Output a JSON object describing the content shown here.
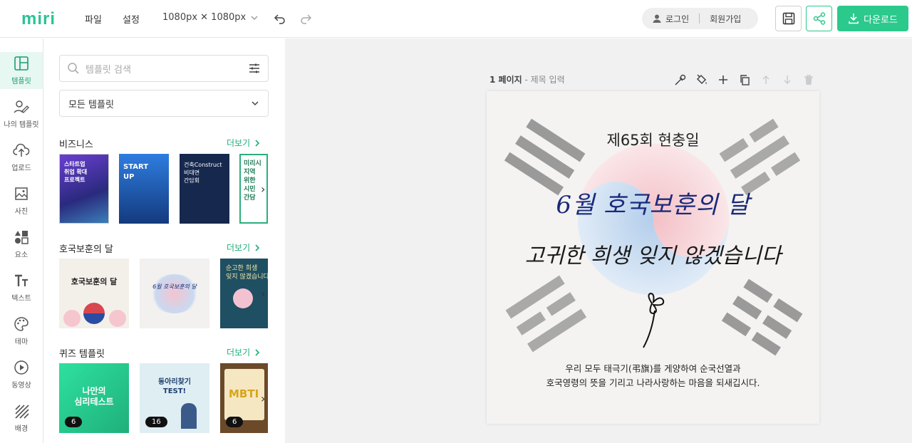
{
  "app": {
    "logo": "miri"
  },
  "header": {
    "menu": [
      "파일",
      "설정"
    ],
    "size_label": "1080px ✕ 1080px",
    "login": "로그인",
    "signup": "회원가입",
    "download": "다운로드",
    "accent": "#2cc98d"
  },
  "sidebar": {
    "items": [
      {
        "label": "템플릿",
        "icon": "template-icon"
      },
      {
        "label": "나의 템플릿",
        "icon": "my-template-icon"
      },
      {
        "label": "업로드",
        "icon": "upload-icon"
      },
      {
        "label": "사진",
        "icon": "photo-icon"
      },
      {
        "label": "요소",
        "icon": "elements-icon"
      },
      {
        "label": "텍스트",
        "icon": "text-icon"
      },
      {
        "label": "테마",
        "icon": "palette-icon"
      },
      {
        "label": "동영상",
        "icon": "video-icon"
      },
      {
        "label": "배경",
        "icon": "background-icon"
      }
    ]
  },
  "panel": {
    "search_placeholder": "템플릿 검색",
    "filter_selected": "모든 템플릿",
    "more_label": "더보기",
    "sections": [
      {
        "title": "비즈니스"
      },
      {
        "title": "호국보훈의 달"
      },
      {
        "title": "퀴즈 템플릿"
      }
    ],
    "business_thumbs": [
      {
        "text": "스타트업\n취업 확대\n프로젝트",
        "bg": "#3a2e8c"
      },
      {
        "text": "START\nUP",
        "bg": "#1c3f8f"
      },
      {
        "text": "건축Construct\n비대면\n간담회",
        "bg": "#16284e"
      },
      {
        "text": "미리시\n지역\n위한\n시민\n간담",
        "bg": "#ffffff"
      }
    ],
    "hoguk_thumbs": [
      {
        "text": "호국보훈의 달",
        "bg": "#f3f0ea"
      },
      {
        "text": "6월 호국보훈의 달",
        "bg": "#f2f1ef"
      },
      {
        "text": "순고한 희생\n잊지 않겠습니다",
        "bg": "#1f4f62"
      }
    ],
    "quiz_thumbs": [
      {
        "text": "나만의\n심리테스트",
        "bg": "#34c98e",
        "count": "6"
      },
      {
        "text": "동아리찾기\nTEST!",
        "bg": "#dfeef3",
        "count": "16"
      },
      {
        "text": "MBTI",
        "bg": "#6b4a2a",
        "count": "6"
      }
    ]
  },
  "page": {
    "number_label": "1 페이지",
    "title_placeholder": "제목 입력"
  },
  "artboard": {
    "title": "제65회 현충일",
    "line1": "6월 호국보훈의 달",
    "line2": "고귀한 희생 잊지 않겠습니다",
    "desc1": "우리 모두 태극기(弔旗)를 게양하여 순국선열과",
    "desc2": "호국영령의 뜻을 기리고 나라사랑하는 마음을 되새깁시다."
  }
}
